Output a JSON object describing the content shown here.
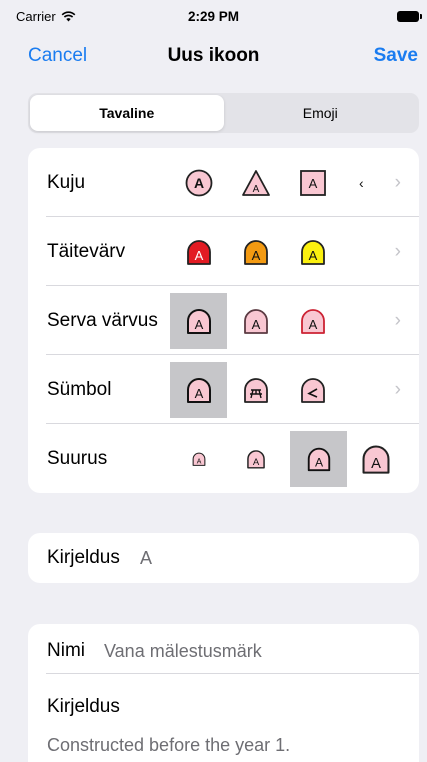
{
  "status_bar": {
    "carrier": "Carrier",
    "time": "2:29 PM"
  },
  "nav": {
    "cancel": "Cancel",
    "title": "Uus ikoon",
    "save": "Save"
  },
  "segment": {
    "tabs": [
      "Tavaline",
      "Emoji"
    ],
    "selected": "Tavaline"
  },
  "style_rows": [
    {
      "label": "Kuju"
    },
    {
      "label": "Täitevärv"
    },
    {
      "label": "Serva värvus"
    },
    {
      "label": "Sümbol"
    },
    {
      "label": "Suurus"
    }
  ],
  "symbol_letter": "A",
  "shape_more_indicator": "‹",
  "colors": {
    "accent": "#1a7cf0",
    "icon_fill_default": "#f9c7d2",
    "fill_red": "#e21b23",
    "fill_orange": "#f39a12",
    "fill_yellow": "#fbf00f",
    "edge_pink": "#d9a0ad",
    "edge_red": "#cc2233"
  },
  "description": {
    "label": "Kirjeldus",
    "value": "A"
  },
  "info": {
    "name_label": "Nimi",
    "name_value": "Vana mälestusmärk",
    "description_label": "Kirjeldus",
    "description_value": "Constructed before the year 1."
  }
}
